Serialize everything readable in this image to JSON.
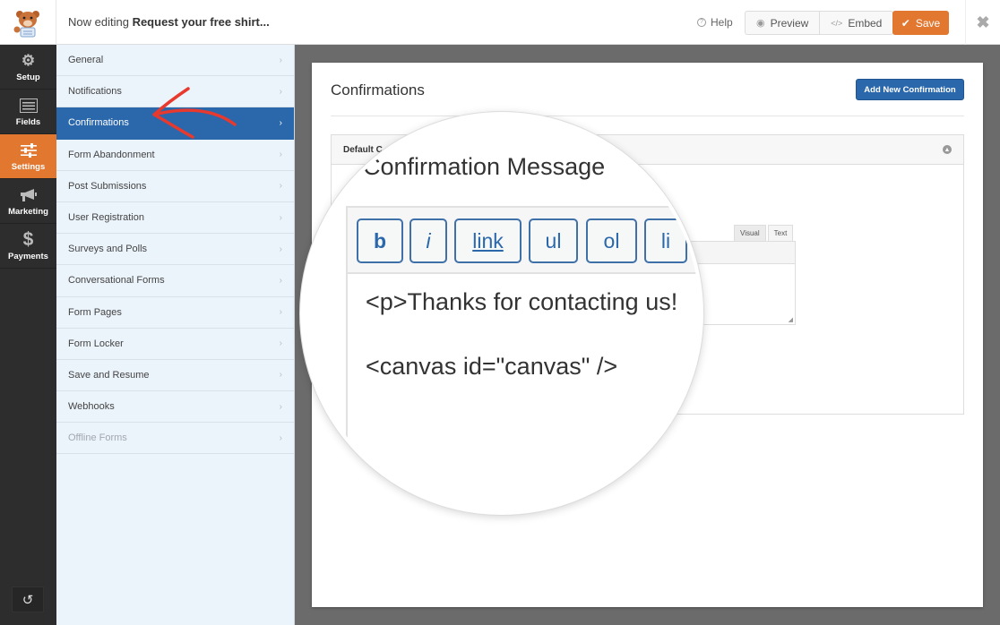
{
  "topbar": {
    "title_prefix": "Now editing",
    "form_name": "Request your free shirt...",
    "help_label": "Help",
    "preview_label": "Preview",
    "embed_label": "Embed",
    "save_label": "Save",
    "icons": {
      "logo": "bear-mascot-logo",
      "help": "question-circle-icon",
      "preview": "eye-icon",
      "embed": "code-icon",
      "save": "checkmark-icon",
      "close": "close-icon"
    }
  },
  "iconbar": {
    "items": [
      {
        "label": "Setup",
        "icon": "gear-icon",
        "glyph": "⚙"
      },
      {
        "label": "Fields",
        "icon": "fields-list-icon",
        "glyph": "▤"
      },
      {
        "label": "Settings",
        "icon": "sliders-icon",
        "glyph": "☰",
        "active": true
      },
      {
        "label": "Marketing",
        "icon": "megaphone-icon",
        "glyph": "📢"
      },
      {
        "label": "Payments",
        "icon": "dollar-icon",
        "glyph": "$"
      }
    ],
    "history_icon": "history-icon",
    "history_glyph": "↺"
  },
  "sidebar": {
    "items": [
      {
        "label": "General"
      },
      {
        "label": "Notifications"
      },
      {
        "label": "Confirmations",
        "active": true
      },
      {
        "label": "Form Abandonment"
      },
      {
        "label": "Post Submissions"
      },
      {
        "label": "User Registration"
      },
      {
        "label": "Surveys and Polls"
      },
      {
        "label": "Conversational Forms"
      },
      {
        "label": "Form Pages"
      },
      {
        "label": "Form Locker"
      },
      {
        "label": "Save and Resume"
      },
      {
        "label": "Webhooks"
      },
      {
        "label": "Offline Forms",
        "disabled": true
      }
    ],
    "chevron": "›"
  },
  "main": {
    "title": "Confirmations",
    "add_button_label": "Add New Confirmation",
    "confirmation_box": {
      "header_label": "Default C",
      "editor_tabs": [
        "Visual",
        "Text"
      ],
      "active_tab": "Text"
    }
  },
  "magnifier": {
    "label": "Confirmation Message",
    "quicktags": [
      "b",
      "i",
      "link",
      "ul",
      "ol",
      "li"
    ],
    "code_lines": [
      "<p>Thanks for contacting us!",
      "<canvas id=\"canvas\" />"
    ]
  },
  "colors": {
    "accent_orange": "#e27730",
    "accent_blue": "#2a67ab",
    "sidebar_bg": "#ebf3fb",
    "iconbar_bg": "#2d2d2d",
    "annotation_arrow": "#e8392e"
  }
}
